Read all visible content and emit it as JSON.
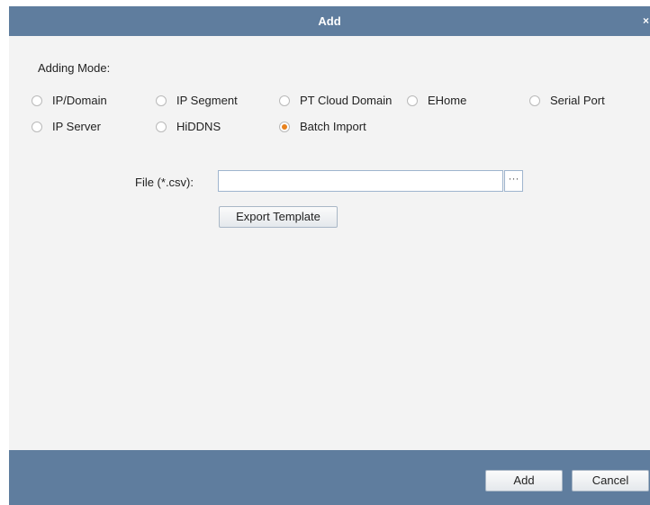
{
  "dialog": {
    "title": "Add",
    "close_label": "×"
  },
  "adding_mode": {
    "label": "Adding Mode:",
    "options": [
      {
        "label": "IP/Domain",
        "selected": false
      },
      {
        "label": "IP Segment",
        "selected": false
      },
      {
        "label": "PT Cloud Domain",
        "selected": false
      },
      {
        "label": "EHome",
        "selected": false
      },
      {
        "label": "Serial Port",
        "selected": false
      },
      {
        "label": "IP Server",
        "selected": false
      },
      {
        "label": "HiDDNS",
        "selected": false
      },
      {
        "label": "Batch Import",
        "selected": true
      }
    ]
  },
  "file": {
    "label": "File (*.csv):",
    "value": "",
    "browse_label": "···"
  },
  "buttons": {
    "export_template": "Export Template",
    "add": "Add",
    "cancel": "Cancel"
  },
  "colors": {
    "title_bar": "#5f7d9e",
    "footer_bar": "#5f7d9e",
    "radio_selected": "#e8811c",
    "panel_background": "#f3f3f3"
  }
}
